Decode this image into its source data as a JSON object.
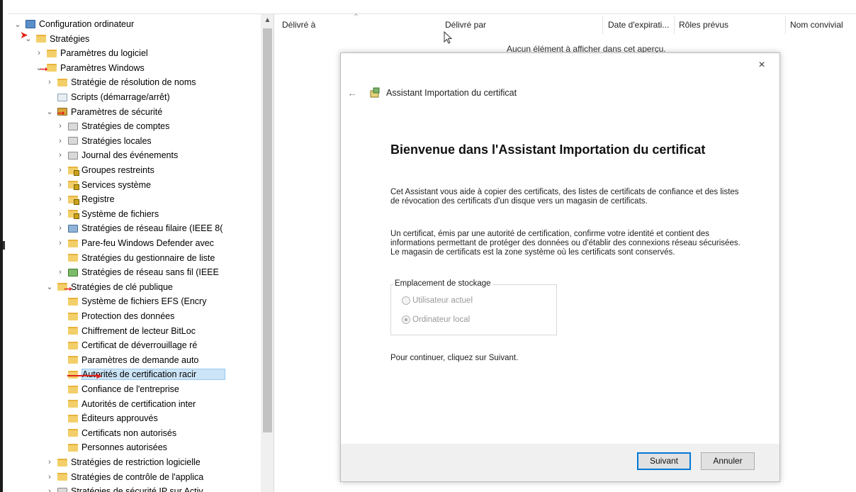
{
  "tree": {
    "items": [
      {
        "label": "Configuration ordinateur",
        "icon": "computer-icon",
        "chevron": "⌄"
      },
      {
        "label": "Stratégies",
        "icon": "folder-icon",
        "chevron": "⌄"
      },
      {
        "label": "Paramètres du logiciel",
        "icon": "folder-icon",
        "chevron": "›"
      },
      {
        "label": "Paramètres Windows",
        "icon": "folder-icon",
        "chevron": "⌄"
      },
      {
        "label": "Stratégie de résolution de noms",
        "icon": "folder-icon",
        "chevron": "›"
      },
      {
        "label": "Scripts (démarrage/arrêt)",
        "icon": "script-icon",
        "chevron": ""
      },
      {
        "label": "Paramètres de sécurité",
        "icon": "security-icon",
        "chevron": "⌄"
      },
      {
        "label": "Stratégies de comptes",
        "icon": "policy-icon",
        "chevron": "›"
      },
      {
        "label": "Stratégies locales",
        "icon": "policy-icon",
        "chevron": "›"
      },
      {
        "label": "Journal des événements",
        "icon": "policy-icon",
        "chevron": "›"
      },
      {
        "label": "Groupes restreints",
        "icon": "locked-folder-icon",
        "chevron": "›"
      },
      {
        "label": "Services système",
        "icon": "locked-folder-icon",
        "chevron": "›"
      },
      {
        "label": "Registre",
        "icon": "locked-folder-icon",
        "chevron": "›"
      },
      {
        "label": "Système de fichiers",
        "icon": "locked-folder-icon",
        "chevron": "›"
      },
      {
        "label": "Stratégies de réseau filaire (IEEE 8(",
        "icon": "network-icon",
        "chevron": "›"
      },
      {
        "label": "Pare-feu Windows Defender avec",
        "icon": "folder-icon",
        "chevron": "›"
      },
      {
        "label": "Stratégies du gestionnaire de liste",
        "icon": "folder-icon",
        "chevron": ""
      },
      {
        "label": "Stratégies de réseau sans fil (IEEE",
        "icon": "wireless-icon",
        "chevron": "›"
      },
      {
        "label": "Stratégies de clé publique",
        "icon": "folder-icon",
        "chevron": "⌄"
      },
      {
        "label": "Système de fichiers EFS (Encry",
        "icon": "folder-icon",
        "chevron": ""
      },
      {
        "label": "Protection des données",
        "icon": "folder-icon",
        "chevron": ""
      },
      {
        "label": "Chiffrement de lecteur BitLoc",
        "icon": "folder-icon",
        "chevron": ""
      },
      {
        "label": "Certificat de déverrouillage ré",
        "icon": "folder-icon",
        "chevron": ""
      },
      {
        "label": "Paramètres de demande auto",
        "icon": "folder-icon",
        "chevron": ""
      },
      {
        "label": "Autorités de certification racir",
        "icon": "folder-icon",
        "chevron": ""
      },
      {
        "label": "Confiance de l'entreprise",
        "icon": "folder-icon",
        "chevron": ""
      },
      {
        "label": "Autorités de certification inter",
        "icon": "folder-icon",
        "chevron": ""
      },
      {
        "label": "Éditeurs approuvés",
        "icon": "folder-icon",
        "chevron": ""
      },
      {
        "label": "Certificats non autorisés",
        "icon": "folder-icon",
        "chevron": ""
      },
      {
        "label": "Personnes autorisées",
        "icon": "folder-icon",
        "chevron": ""
      },
      {
        "label": "Stratégies de restriction logicielle",
        "icon": "folder-icon",
        "chevron": "›"
      },
      {
        "label": "Stratégies de contrôle de l'applica",
        "icon": "folder-icon",
        "chevron": "›"
      },
      {
        "label": "Stratégies de sécurité IP sur Activ",
        "icon": "policy-icon",
        "chevron": "›"
      }
    ],
    "selected_label": "Autorités de certification racir"
  },
  "list": {
    "columns": [
      "Délivré à",
      "Délivré par",
      "Date d'expirati...",
      "Rôles prévus",
      "Nom convivial"
    ],
    "empty_message": "Aucun élément à afficher dans cet aperçu."
  },
  "dialog": {
    "title": "Assistant Importation du certificat",
    "close": "×",
    "back": "←",
    "heading": "Bienvenue dans l'Assistant Importation du certificat",
    "para1": "Cet Assistant vous aide à copier des certificats, des listes de certificats de confiance et des listes de révocation des certificats d'un disque vers un magasin de certificats.",
    "para2": "Un certificat, émis par une autorité de certification, confirme votre identité et contient des informations permettant de protéger des données ou d'établir des connexions réseau sécurisées. Le magasin de certificats est la zone système où les certificats sont conservés.",
    "storage_legend": "Emplacement de stockage",
    "option_user": "Utilisateur actuel",
    "option_machine": "Ordinateur local",
    "selected_option": "Ordinateur local",
    "continue_text": "Pour continuer, cliquez sur Suivant.",
    "next_label": "Suivant",
    "cancel_label": "Annuler"
  },
  "colors": {
    "annotation_arrow": "#e0231a",
    "selection": "#cce4f7",
    "focus_border": "#0078d7"
  }
}
